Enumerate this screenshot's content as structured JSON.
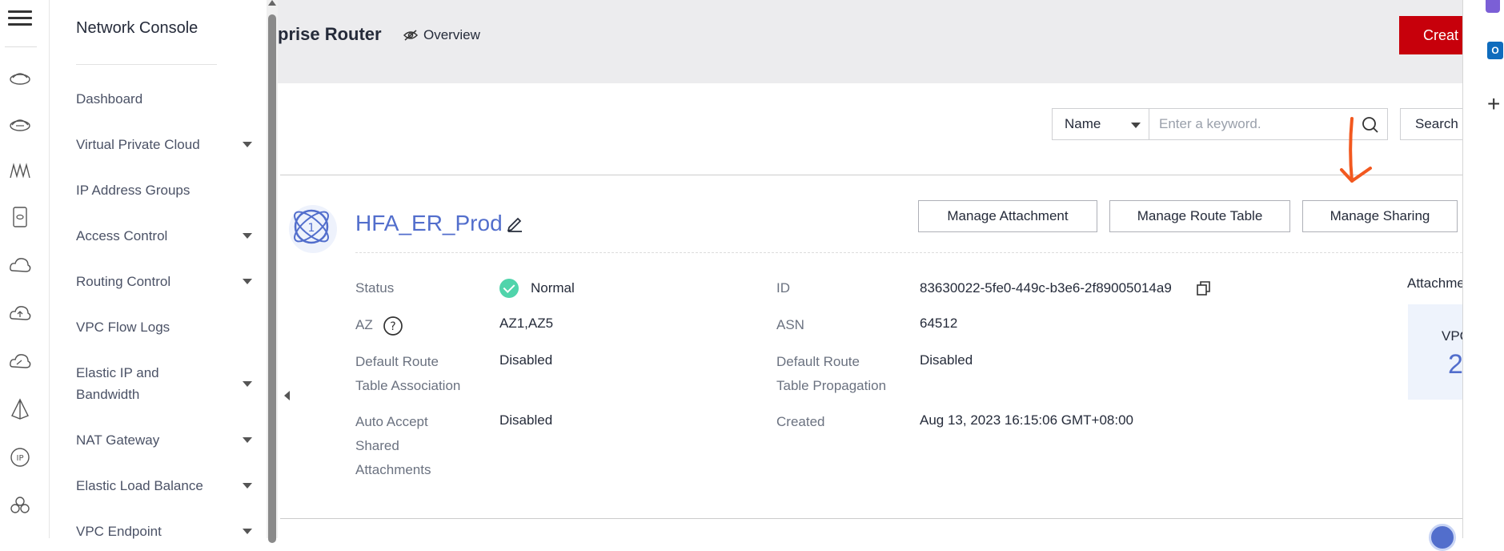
{
  "sidebar": {
    "title": "Network Console",
    "items": [
      {
        "label": "Dashboard",
        "has_submenu": false
      },
      {
        "label": "Virtual Private Cloud",
        "has_submenu": true
      },
      {
        "label": "IP Address Groups",
        "has_submenu": false
      },
      {
        "label": "Access Control",
        "has_submenu": true
      },
      {
        "label": "Routing Control",
        "has_submenu": true
      },
      {
        "label": "VPC Flow Logs",
        "has_submenu": false
      },
      {
        "label": "Elastic IP and Bandwidth",
        "has_submenu": true
      },
      {
        "label": "NAT Gateway",
        "has_submenu": true
      },
      {
        "label": "Elastic Load Balance",
        "has_submenu": true
      },
      {
        "label": "VPC Endpoint",
        "has_submenu": true
      }
    ]
  },
  "rail_icons": [
    "menu-icon",
    "router-icon",
    "cloud-router-icon",
    "network-icon",
    "server-icon",
    "cloud-icon",
    "cloud-upload-icon",
    "cloud-speed-icon",
    "balance-icon",
    "ip-icon",
    "cluster-icon"
  ],
  "header": {
    "title": "prise Router",
    "overview_label": "Overview",
    "create_label": "Creat"
  },
  "search": {
    "filter_value": "Name",
    "placeholder": "Enter a keyword.",
    "button_label": "Search"
  },
  "router": {
    "name": "HFA_ER_Prod",
    "actions": [
      "Manage Attachment",
      "Manage Route Table",
      "Manage Sharing"
    ],
    "fields_left": [
      {
        "label": "Status",
        "value": "Normal"
      },
      {
        "label": "AZ",
        "value": "AZ1,AZ5"
      },
      {
        "label": "Default Route\nTable Association",
        "value": "Disabled"
      },
      {
        "label": "Auto Accept\nShared\nAttachments",
        "value": "Disabled"
      }
    ],
    "fields_right": [
      {
        "label": "ID",
        "value": "83630022-5fe0-449c-b3e6-2f89005014a9"
      },
      {
        "label": "ASN",
        "value": "64512"
      },
      {
        "label": "Default Route\nTable Propagation",
        "value": "Disabled"
      },
      {
        "label": "Created",
        "value": "Aug 13, 2023 16:15:06 GMT+08:00"
      }
    ],
    "attachments_label": "Attachme",
    "vpc_label": "VPC",
    "vpc_count": "2"
  },
  "colors": {
    "accent": "#526ecc",
    "create": "#c7000b",
    "status_ok": "#50d4ab",
    "annotation": "#f2581f"
  }
}
